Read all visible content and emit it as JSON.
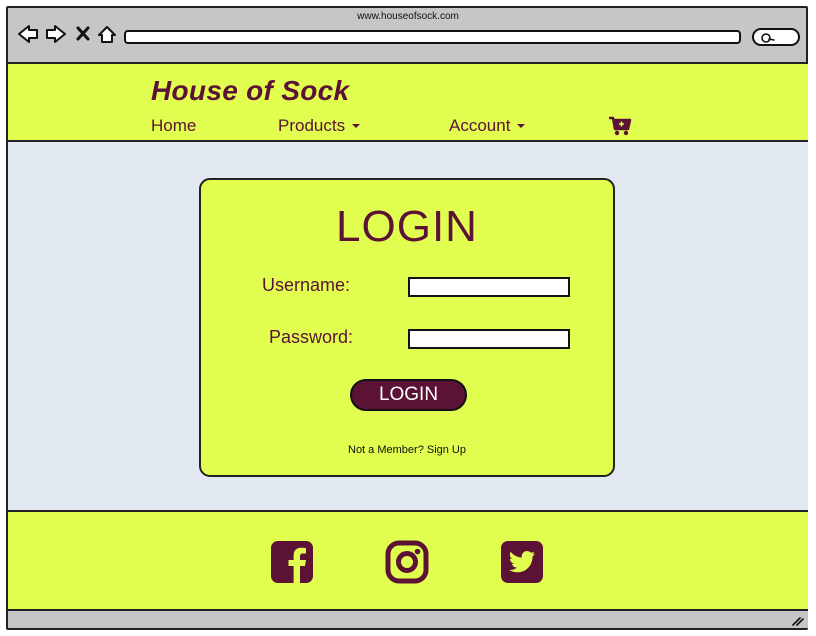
{
  "browser": {
    "title": "www.houseofsock.com",
    "address_value": ""
  },
  "header": {
    "brand": "House of Sock",
    "nav": [
      {
        "label": "Home",
        "has_dropdown": false
      },
      {
        "label": "Products",
        "has_dropdown": true
      },
      {
        "label": "Account",
        "has_dropdown": true
      }
    ],
    "cart_icon": "cart-plus-icon"
  },
  "login": {
    "title": "LOGIN",
    "username_label": "Username:",
    "username_value": "",
    "password_label": "Password:",
    "password_value": "",
    "button_label": "LOGIN",
    "signup_text": "Not a Member? Sign Up"
  },
  "footer": {
    "social_icons": [
      "facebook-icon",
      "instagram-icon",
      "twitter-icon"
    ]
  },
  "colors": {
    "accent_yellow": "#e1fd4f",
    "brand_maroon": "#5b1235",
    "page_bg": "#e3e9f1",
    "chrome_gray": "#c6c6c6"
  }
}
